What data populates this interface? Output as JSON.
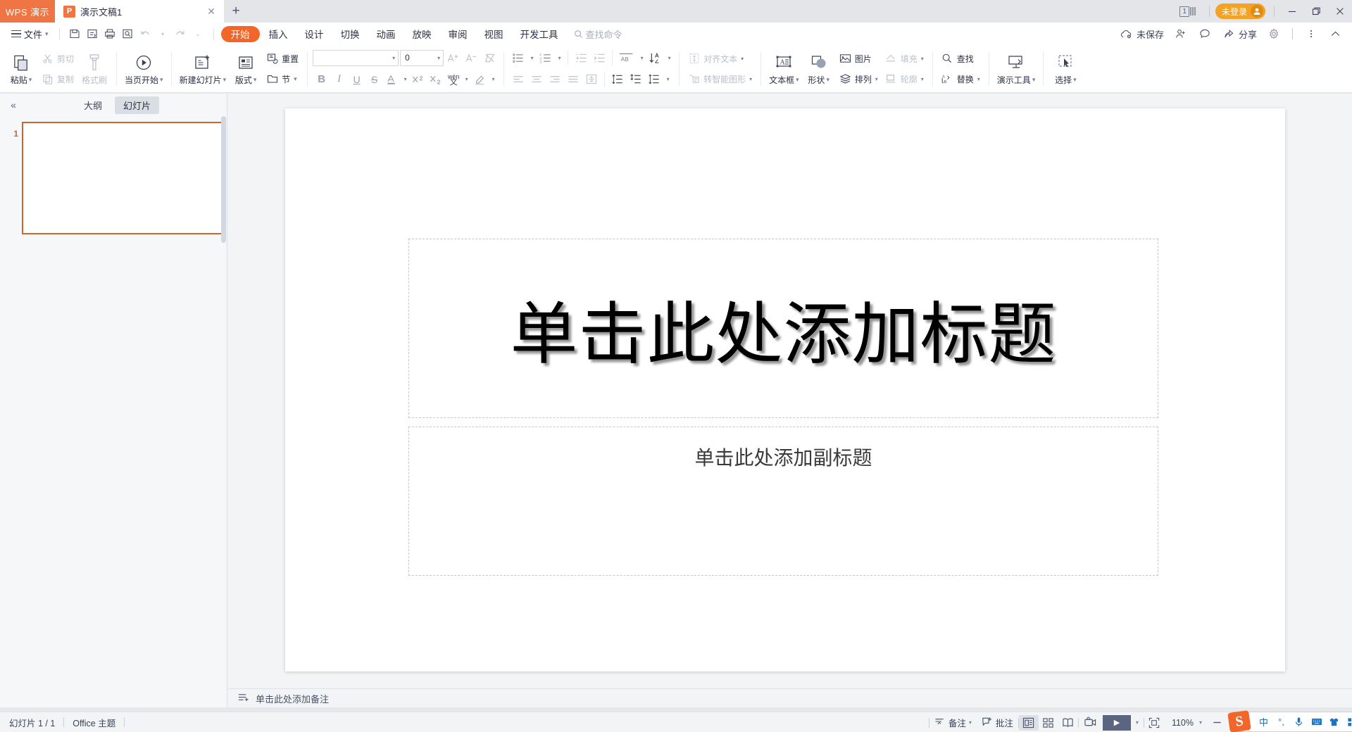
{
  "titlebar": {
    "brand": "WPS 演示",
    "tab": {
      "file_icon_letter": "P",
      "name": "演示文稿1",
      "close": "✕"
    },
    "new_tab": "+",
    "window_count": "1",
    "login_label": "未登录",
    "minimize": "—",
    "restore": "❐",
    "close": "✕"
  },
  "menubar": {
    "file_label": "文件",
    "quick_access": [
      "save-icon",
      "save-as-cloud-icon",
      "print-icon",
      "print-preview-icon",
      "undo-icon",
      "redo-icon",
      "customize-icon"
    ],
    "tabs": [
      {
        "label": "开始",
        "active": true
      },
      {
        "label": "插入",
        "active": false
      },
      {
        "label": "设计",
        "active": false
      },
      {
        "label": "切换",
        "active": false
      },
      {
        "label": "动画",
        "active": false
      },
      {
        "label": "放映",
        "active": false
      },
      {
        "label": "审阅",
        "active": false
      },
      {
        "label": "视图",
        "active": false
      },
      {
        "label": "开发工具",
        "active": false
      }
    ],
    "find_command": "查找命令",
    "right_items": [
      {
        "label": "未保存",
        "icon": "cloud-unsaved-icon"
      },
      {
        "label": "协作",
        "icon": "collaborate-icon"
      },
      {
        "label": "",
        "icon": "comment-icon"
      },
      {
        "label": "分享",
        "icon": "share-icon"
      },
      {
        "label": "",
        "icon": "gear-icon"
      },
      {
        "label": "",
        "icon": "more-vertical-icon"
      },
      {
        "label": "",
        "icon": "collapse-ribbon-icon"
      }
    ]
  },
  "ribbon": {
    "paste": "粘贴",
    "cut": "剪切",
    "copy": "复制",
    "format_painter": "格式刷",
    "start_from_current": "当页开始",
    "new_slide": "新建幻灯片",
    "layout": "版式",
    "reset": "重置",
    "section": "节",
    "font_name": "",
    "font_name_placeholder": "",
    "font_size": "0",
    "increase_font": "A",
    "decrease_font": "A",
    "clear_format": "clear-format-icon",
    "bold": "B",
    "italic": "I",
    "underline": "U",
    "strikethrough": "S",
    "font_color": "A",
    "superscript": "X²",
    "subscript": "X₂",
    "pinyin": "wén",
    "highlight": "highlight-icon",
    "bullets": "bullets-icon",
    "numbering": "numbering-icon",
    "decrease_indent": "decrease-indent-icon",
    "increase_indent": "increase-indent-icon",
    "text_direction": "AB",
    "sort": "sort-icon",
    "align_left": "align-left-icon",
    "align_center": "align-center-icon",
    "align_right": "align-right-icon",
    "align_justify": "align-justify-icon",
    "distribute": "distribute-icon",
    "line_spacing_1": "line-spacing-icon",
    "line_spacing_2": "space-before-icon",
    "line_spacing_3": "line-spacing-menu-icon",
    "align_text": "对齐文本",
    "convert_smartart": "转智能图形",
    "text_box": "文本框",
    "shapes": "形状",
    "picture": "图片",
    "arrange": "排列",
    "fill": "填充",
    "outline": "轮廓",
    "find": "查找",
    "replace": "替换",
    "present_tools": "演示工具",
    "select": "选择"
  },
  "slide_panel": {
    "collapse": "«",
    "tabs": [
      {
        "label": "大纲",
        "active": false
      },
      {
        "label": "幻灯片",
        "active": true
      }
    ],
    "slides": [
      {
        "number": "1"
      }
    ]
  },
  "slide": {
    "title_placeholder": "单击此处添加标题",
    "subtitle_placeholder": "单击此处添加副标题"
  },
  "notes": {
    "placeholder": "单击此处添加备注",
    "icon": "add-notes-icon"
  },
  "statusbar": {
    "slide_count": "幻灯片 1 / 1",
    "theme": "Office 主题",
    "notes_button": "备注",
    "comments_button": "批注",
    "views": [
      {
        "name": "normal-view",
        "active": true
      },
      {
        "name": "slide-sorter-view",
        "active": false
      },
      {
        "name": "reading-view",
        "active": false
      }
    ],
    "record_icon": "record-screen-icon",
    "play_label": "▶",
    "fit_icon": "fit-to-window-icon",
    "zoom_level": "110%",
    "zoom_out": "—"
  },
  "ime": {
    "logo": "S",
    "items": [
      "中",
      "°,",
      "mic-icon",
      "keyboard-icon",
      "skin-icon",
      "apps-icon"
    ]
  },
  "colors": {
    "brand_orange": "#ef7644",
    "tab_active": "#f2662a",
    "slide_select": "#d0642a",
    "login_yellow": "#f2a325",
    "ime_blue": "#1a73c8"
  }
}
